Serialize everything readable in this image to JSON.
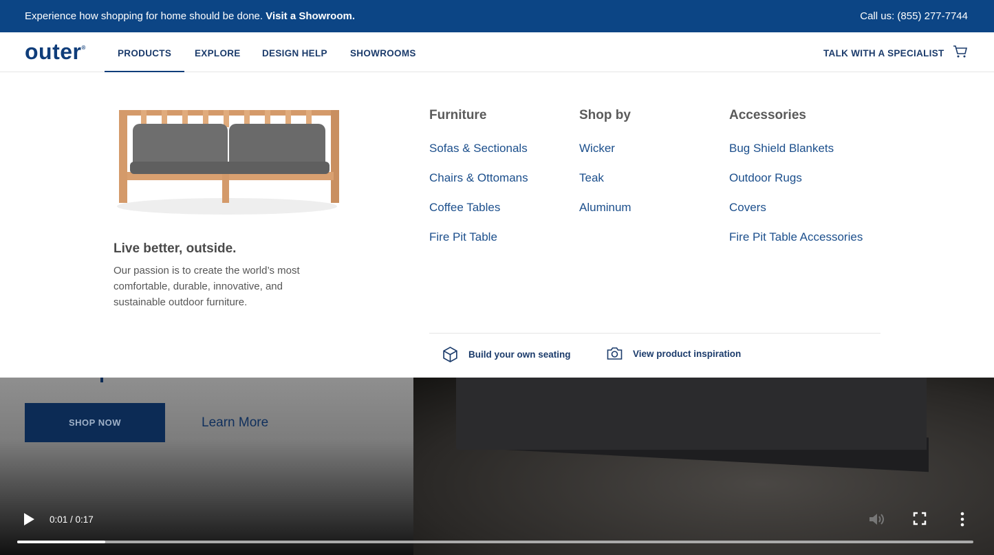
{
  "topbar": {
    "message": "Experience how shopping for home should be done.",
    "link": "Visit a Showroom.",
    "phone": "Call us: (855) 277-7744"
  },
  "nav": {
    "logo": "outer",
    "items": [
      {
        "label": "PRODUCTS",
        "active": true
      },
      {
        "label": "EXPLORE"
      },
      {
        "label": "DESIGN HELP"
      },
      {
        "label": "SHOWROOMS"
      }
    ],
    "specialist": "TALK WITH A SPECIALIST",
    "cart_icon": "cart-icon"
  },
  "mega": {
    "tagline": "Live better, outside.",
    "description": "Our passion is to create the world’s most comfortable, durable, innovative, and sustainable outdoor furniture.",
    "columns": [
      {
        "title": "Furniture",
        "items": [
          "Sofas & Sectionals",
          "Chairs & Ottomans",
          "Coffee Tables",
          "Fire Pit Table"
        ]
      },
      {
        "title": "Shop by",
        "items": [
          "Wicker",
          "Teak",
          "Aluminum"
        ]
      },
      {
        "title": "Accessories",
        "items": [
          "Bug Shield Blankets",
          "Outdoor Rugs",
          "Covers",
          "Fire Pit Table Accessories"
        ]
      }
    ],
    "bottom_links": [
      {
        "label": "Build your own seating",
        "icon": "cube-icon"
      },
      {
        "label": "View product inspiration",
        "icon": "camera-icon"
      }
    ]
  },
  "hero": {
    "shop_now": "SHOP NOW",
    "learn_more": "Learn More"
  },
  "video": {
    "time": "0:01 / 0:17",
    "progress_percent": 9.2
  }
}
